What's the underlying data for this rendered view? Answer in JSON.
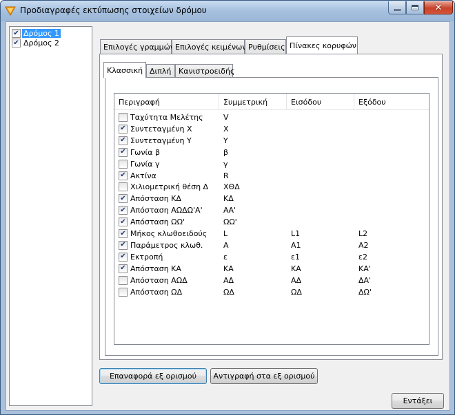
{
  "window": {
    "title": "Προδιαγραφές εκτύπωσης στοιχείων δρόμου",
    "icon": "app-logo-icon"
  },
  "tree": {
    "items": [
      {
        "label": "Δρόμος 1",
        "checked": true,
        "selected": true
      },
      {
        "label": "Δρόμος 2",
        "checked": true,
        "selected": false
      }
    ]
  },
  "tabs": {
    "items": [
      {
        "label": "Επιλογές γραμμών"
      },
      {
        "label": "Επιλογές κειμένων"
      },
      {
        "label": "Ρυθμίσεις"
      },
      {
        "label": "Πίνακες κορυφών"
      }
    ],
    "active": 3
  },
  "subtabs": {
    "items": [
      {
        "label": "Κλασσική"
      },
      {
        "label": "Διπλή"
      },
      {
        "label": "Κανιστροειδής"
      }
    ],
    "active": 0
  },
  "table": {
    "columns": [
      "Περιγραφή",
      "Συμμετρική",
      "Εισόδου",
      "Εξόδου"
    ],
    "rows": [
      {
        "checked": false,
        "cells": [
          "Ταχύτητα Μελέτης",
          "V",
          "",
          ""
        ]
      },
      {
        "checked": true,
        "cells": [
          "Συντεταγμένη Χ",
          "Χ",
          "",
          ""
        ]
      },
      {
        "checked": true,
        "cells": [
          "Συντεταγμένη Υ",
          "Υ",
          "",
          ""
        ]
      },
      {
        "checked": true,
        "cells": [
          "Γωνία β",
          "β",
          "",
          ""
        ]
      },
      {
        "checked": false,
        "cells": [
          "Γωνία γ",
          "γ",
          "",
          ""
        ]
      },
      {
        "checked": true,
        "cells": [
          "Ακτίνα",
          "R",
          "",
          ""
        ]
      },
      {
        "checked": false,
        "cells": [
          "Χιλιομετρική θέση Δ",
          "ΧΘΔ",
          "",
          ""
        ]
      },
      {
        "checked": true,
        "cells": [
          "Απόσταση ΚΔ",
          "ΚΔ",
          "",
          ""
        ]
      },
      {
        "checked": true,
        "cells": [
          "Απόσταση ΑΩΔΩ'Α'",
          "ΑΑ'",
          "",
          ""
        ]
      },
      {
        "checked": true,
        "cells": [
          "Απόσταση ΩΩ'",
          "ΩΩ'",
          "",
          ""
        ]
      },
      {
        "checked": true,
        "cells": [
          "Μήκος κλωθοειδούς",
          "L",
          "L1",
          "L2"
        ]
      },
      {
        "checked": true,
        "cells": [
          "Παράμετρος κλωθ.",
          "A",
          "A1",
          "A2"
        ]
      },
      {
        "checked": true,
        "cells": [
          "Εκτροπή",
          "ε",
          "ε1",
          "ε2"
        ]
      },
      {
        "checked": true,
        "cells": [
          "Απόσταση ΚΑ",
          "ΚΑ",
          "ΚΑ",
          "ΚΑ'"
        ]
      },
      {
        "checked": false,
        "cells": [
          "Απόσταση ΑΩΔ",
          "ΑΔ",
          "ΑΔ",
          "ΔΑ'"
        ]
      },
      {
        "checked": false,
        "cells": [
          "Απόσταση ΩΔ",
          "ΩΔ",
          "ΩΔ",
          "ΔΩ'"
        ]
      }
    ]
  },
  "buttons": {
    "reset_defaults": "Επαναφορά εξ ορισμού",
    "copy_to_defaults": "Αντιγραφή στα εξ ορισμού",
    "ok": "Εντάξει"
  }
}
